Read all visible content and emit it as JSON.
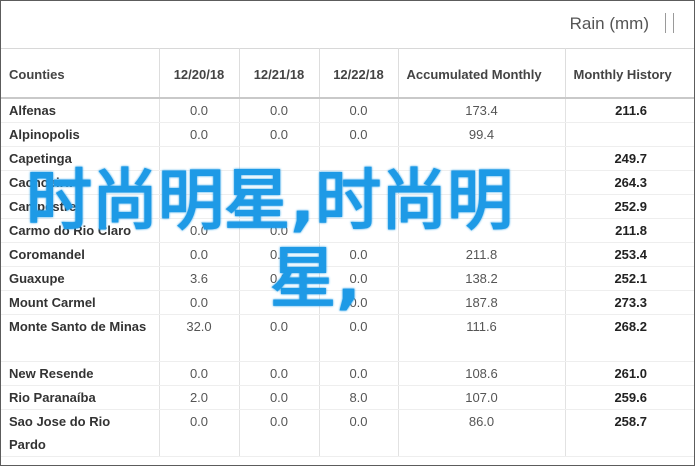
{
  "header": {
    "title": "Rain (mm)"
  },
  "table": {
    "columns": [
      "Counties",
      "12/20/18",
      "12/21/18",
      "12/22/18",
      "Accumulated Monthly",
      "Monthly History"
    ],
    "rows": [
      [
        "Alfenas",
        "0.0",
        "0.0",
        "0.0",
        "173.4",
        "211.6"
      ],
      [
        "Alpinopolis",
        "0.0",
        "0.0",
        "0.0",
        "99.4",
        ""
      ],
      [
        "Capetinga",
        "",
        "",
        "",
        "",
        "249.7"
      ],
      [
        "Cachoeira",
        "",
        "",
        "",
        "",
        "264.3"
      ],
      [
        "Campestre",
        "",
        "",
        "",
        "",
        "252.9"
      ],
      [
        "Carmo do Rio Claro",
        "0.0",
        "0.0",
        "",
        "",
        "211.8"
      ],
      [
        "Coromandel",
        "0.0",
        "0.0",
        "0.0",
        "211.8",
        "253.4"
      ],
      [
        "Guaxupe",
        "3.6",
        "0.0",
        "0.0",
        "138.2",
        "252.1"
      ],
      [
        "Mount Carmel",
        "0.0",
        "",
        "0.0",
        "187.8",
        "273.3"
      ],
      [
        "Monte Santo de Minas",
        "32.0",
        "0.0",
        "0.0",
        "111.6",
        "268.2"
      ],
      [
        "New Resende",
        "0.0",
        "0.0",
        "0.0",
        "108.6",
        "261.0"
      ],
      [
        "Rio Paranaíba",
        "2.0",
        "0.0",
        "8.0",
        "107.0",
        "259.6"
      ],
      [
        "Sao Jose do Rio Pardo",
        "0.0",
        "0.0",
        "0.0",
        "86.0",
        "258.7"
      ]
    ]
  },
  "watermark": {
    "line1": "时尚明星,时尚明",
    "line2": "星,"
  },
  "colors": {
    "watermark": "#1e9ae6",
    "border": "#5c5c5c",
    "text": "#333333"
  }
}
